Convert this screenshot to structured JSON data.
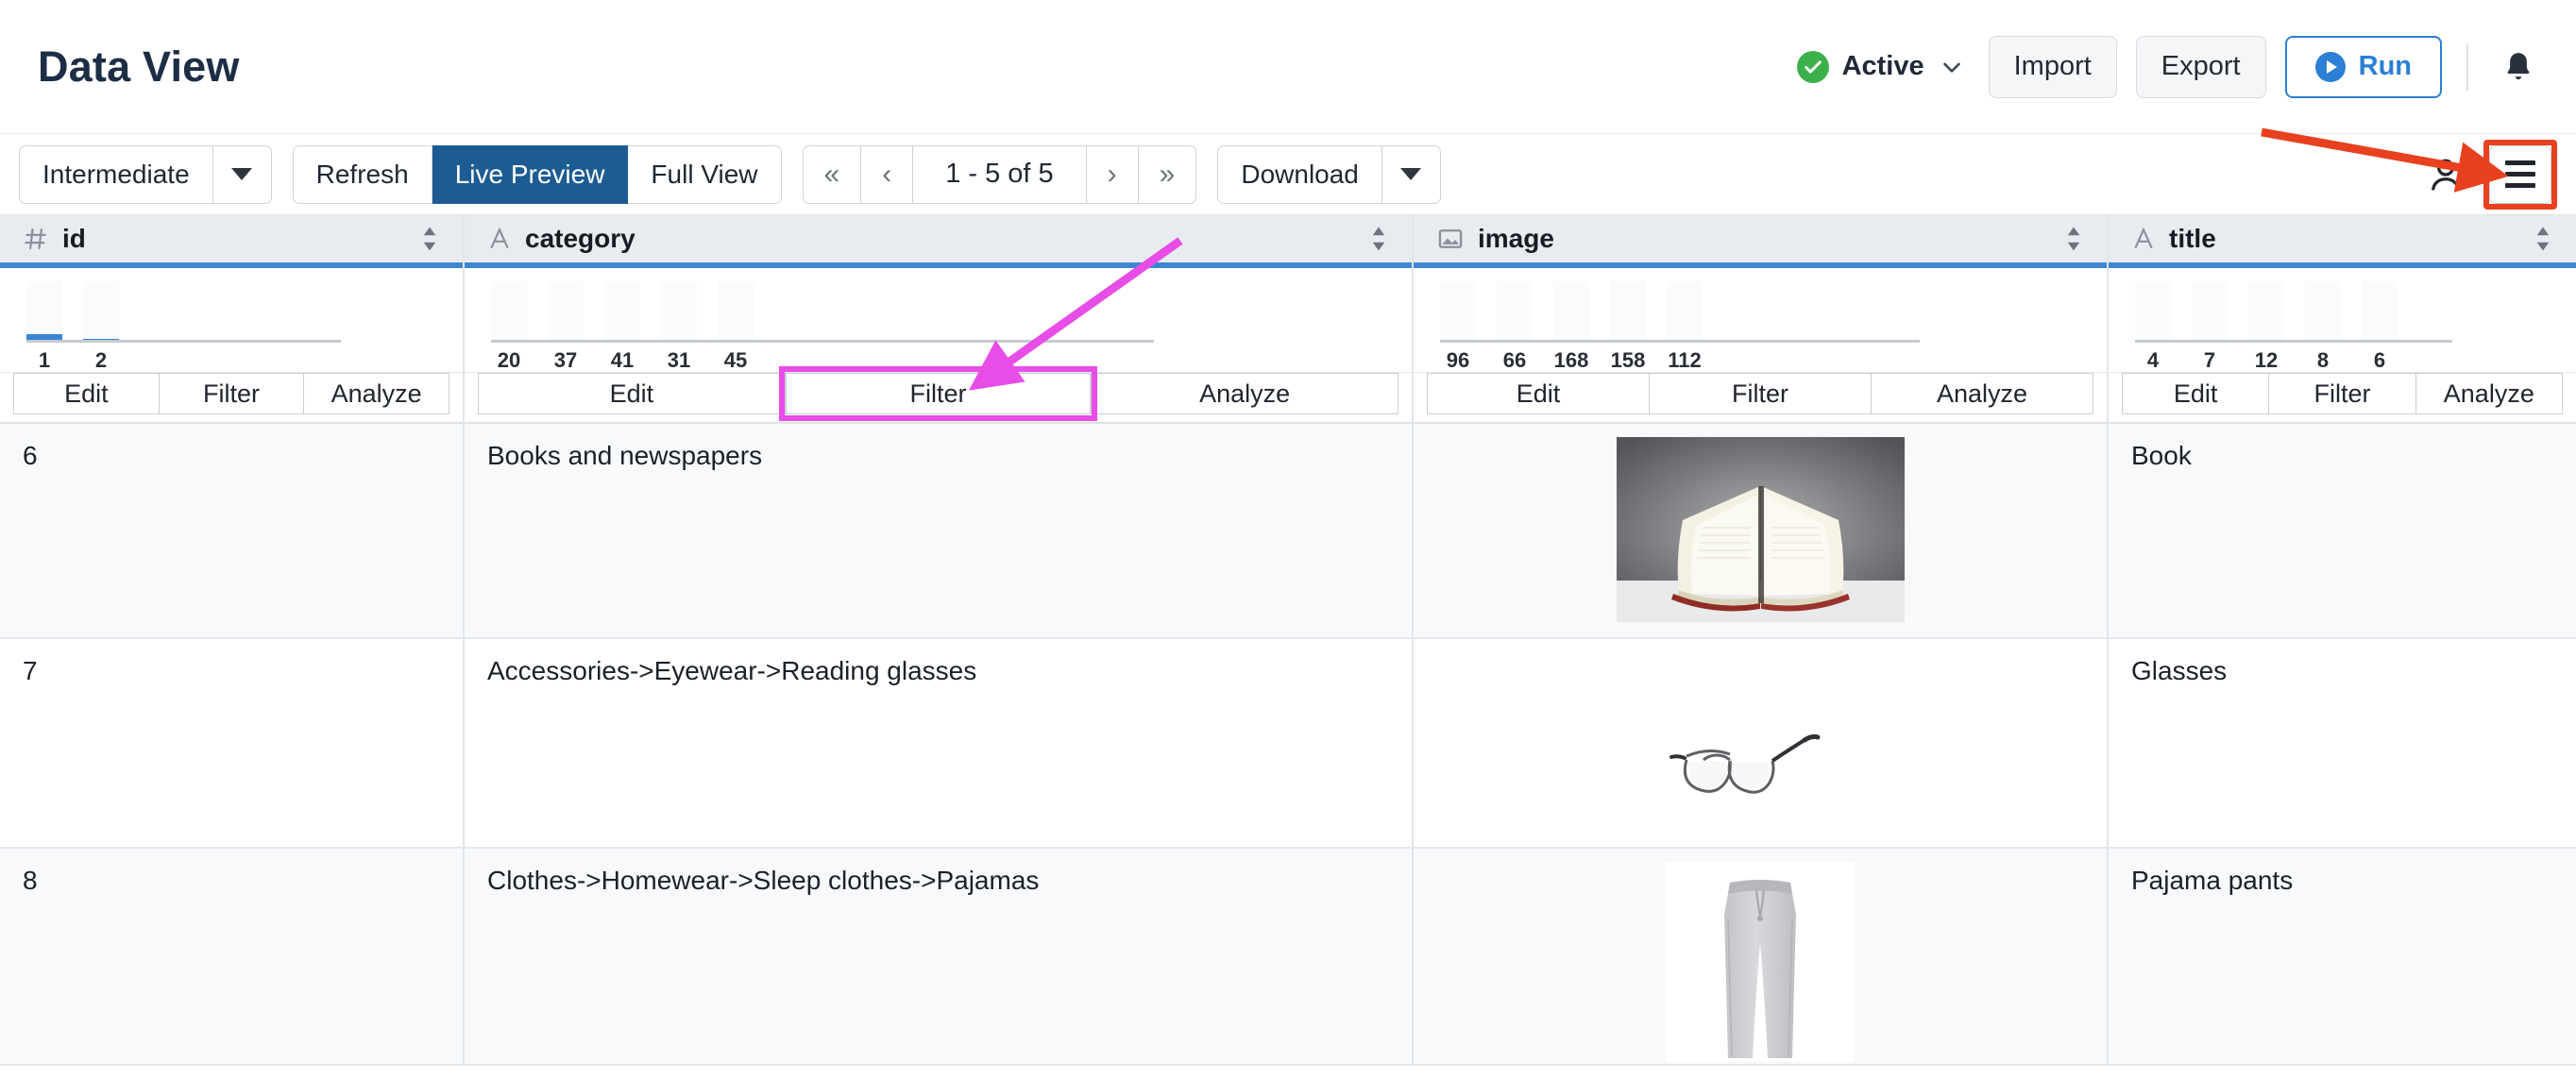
{
  "header": {
    "title": "Data View",
    "status": {
      "label": "Active",
      "color": "#3cb14a",
      "icon": "check-circle-icon",
      "chevron": "chevron-down-icon"
    },
    "import_label": "Import",
    "export_label": "Export",
    "run_label": "Run",
    "bell_icon": "notification-bell-icon"
  },
  "toolbar": {
    "mode_label": "Intermediate",
    "refresh_label": "Refresh",
    "live_preview_label": "Live Preview",
    "full_view_label": "Full View",
    "first_page": "«",
    "prev_page": "‹",
    "page_info": "1 - 5 of 5",
    "next_page": "›",
    "last_page": "»",
    "download_label": "Download",
    "user_icon": "user-account-icon",
    "menu_icon": "hamburger-menu-icon"
  },
  "grid": {
    "columns": [
      {
        "key": "id",
        "label": "id",
        "type_icon": "number-hash-icon"
      },
      {
        "key": "category",
        "label": "category",
        "type_icon": "text-letter-a-icon"
      },
      {
        "key": "image",
        "label": "image",
        "type_icon": "picture-image-icon"
      },
      {
        "key": "title",
        "label": "title",
        "type_icon": "text-letter-a-icon"
      }
    ],
    "actions": {
      "edit": "Edit",
      "filter": "Filter",
      "analyze": "Analyze"
    },
    "rows": [
      {
        "id": "6",
        "category": "Books and newspapers",
        "image_alt": "open-book-photo",
        "title": "Book"
      },
      {
        "id": "7",
        "category": "Accessories->Eyewear->Reading glasses",
        "image_alt": "eyeglasses-photo",
        "title": "Glasses"
      },
      {
        "id": "8",
        "category": "Clothes->Homewear->Sleep clothes->Pajamas",
        "image_alt": "grey-pajama-pants-photo",
        "title": "Pajama pants"
      }
    ]
  },
  "chart_data": [
    {
      "type": "bar",
      "title": "id column distribution",
      "categories": [
        "1",
        "2"
      ],
      "values": [
        10,
        2
      ],
      "ylim": [
        0,
        100
      ],
      "grid": false,
      "xlabel": "",
      "ylabel": ""
    },
    {
      "type": "bar",
      "title": "category column distribution",
      "categories": [
        "20",
        "37",
        "41",
        "31",
        "45"
      ],
      "values": [
        0,
        0,
        0,
        0,
        0
      ],
      "ylim": [
        0,
        100
      ],
      "grid": false,
      "xlabel": "",
      "ylabel": ""
    },
    {
      "type": "bar",
      "title": "image column distribution",
      "categories": [
        "96",
        "66",
        "168",
        "158",
        "112"
      ],
      "values": [
        0,
        0,
        0,
        0,
        0
      ],
      "ylim": [
        0,
        100
      ],
      "grid": false,
      "xlabel": "",
      "ylabel": ""
    },
    {
      "type": "bar",
      "title": "title column distribution",
      "categories": [
        "4",
        "7",
        "12",
        "8",
        "6"
      ],
      "values": [
        0,
        0,
        0,
        0,
        0
      ],
      "ylim": [
        0,
        100
      ],
      "grid": false,
      "xlabel": "",
      "ylabel": ""
    }
  ],
  "annotations": {
    "arrow_red_color": "#e8411f",
    "arrow_magenta_color": "#e84de8",
    "highlight_menu_target": "hamburger-menu-icon",
    "highlight_filter_target": "category-filter-button"
  }
}
